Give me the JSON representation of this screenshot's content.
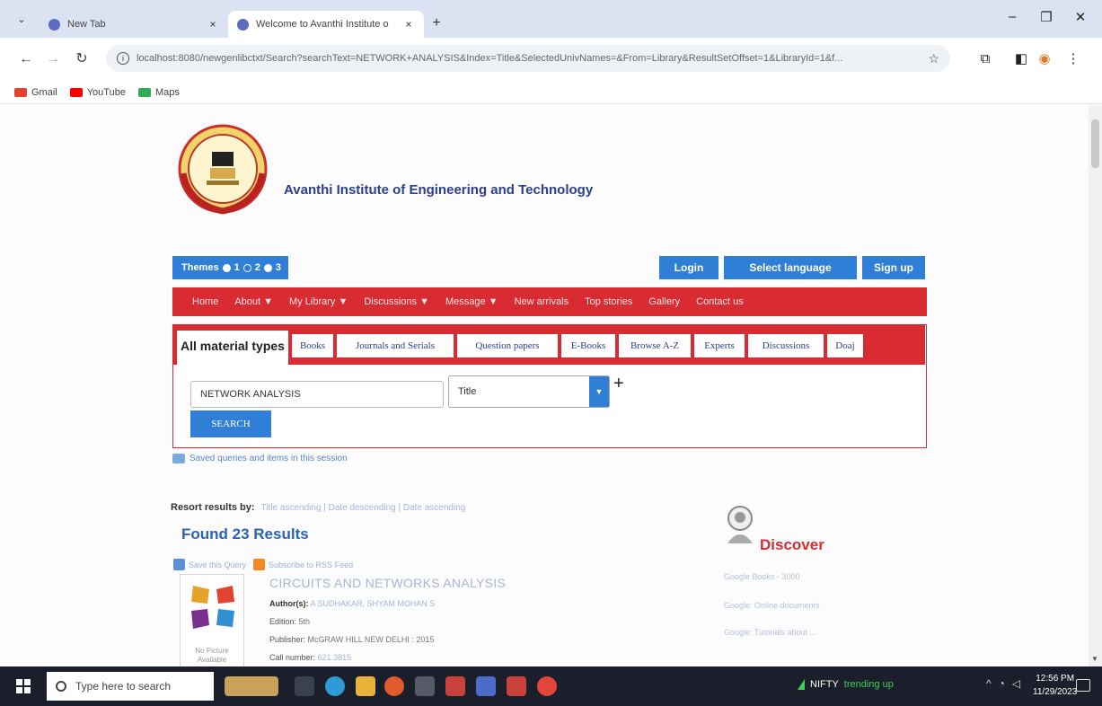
{
  "browser": {
    "tabs": [
      {
        "title": "New Tab",
        "active": false
      },
      {
        "title": "Welcome to Avanthi Institute o",
        "active": true
      }
    ],
    "url": "localhost:8080/newgenlibctxt/Search?searchText=NETWORK+ANALYSIS&Index=Title&SelectedUnivNames=&From=Library&ResultSetOffset=1&LibraryId=1&f...",
    "bookmarks": [
      "Gmail",
      "YouTube",
      "Maps"
    ]
  },
  "site": {
    "title": "Avanthi Institute of Engineering and Technology",
    "themes_label": "Themes",
    "theme_options": [
      "1",
      "2",
      "3"
    ],
    "login": "Login",
    "select_language": "Select language",
    "signup": "Sign up",
    "menu": [
      "Home",
      "About ▼",
      "My Library ▼",
      "Discussions ▼",
      "Message ▼",
      "New arrivals",
      "Top stories",
      "Gallery",
      "Contact us"
    ]
  },
  "search": {
    "tabs": [
      "All material types",
      "Books",
      "Journals and Serials",
      "Question papers",
      "E-Books",
      "Browse A-Z",
      "Experts",
      "Discussions",
      "Doaj"
    ],
    "query": "NETWORK ANALYSIS",
    "index": "Title",
    "plus": "+",
    "button": "SEARCH",
    "saved_link": "Saved queries and items in this session"
  },
  "results": {
    "resort_label": "Resort results by:",
    "resort_options": "Title ascending | Date descending | Date ascending",
    "found": "Found 23 Results",
    "save_query": "Save this Query",
    "subscribe": "Subscribe to RSS Feed",
    "items": [
      {
        "title": "CIRCUITS AND NETWORKS ANALYSIS",
        "author_label": "Author(s):",
        "author": "A SUDHAKAR, SHYAM MOHAN S",
        "edition_label": "Edition:",
        "edition": "5th",
        "publisher_label": "Publisher:",
        "publisher": "McGRAW HILL NEW DELHI : 2015",
        "call_label": "Call number:",
        "call": "621.3815",
        "nopic_caption": "No Picture Available"
      }
    ]
  },
  "discover": {
    "title": "Discover",
    "lines": [
      "Google Books - 3000",
      "Google: Online documents",
      "Google: Tutorials about ..."
    ]
  },
  "taskbar": {
    "search_placeholder": "Type here to search",
    "nifty": "NIFTY",
    "nifty_status": "trending up",
    "time": "12:56 PM",
    "date": "11/29/2023"
  },
  "colors": {
    "brand_red": "#d92b32",
    "brand_blue": "#2f7fd6",
    "title_blue": "#2c3e8f"
  }
}
